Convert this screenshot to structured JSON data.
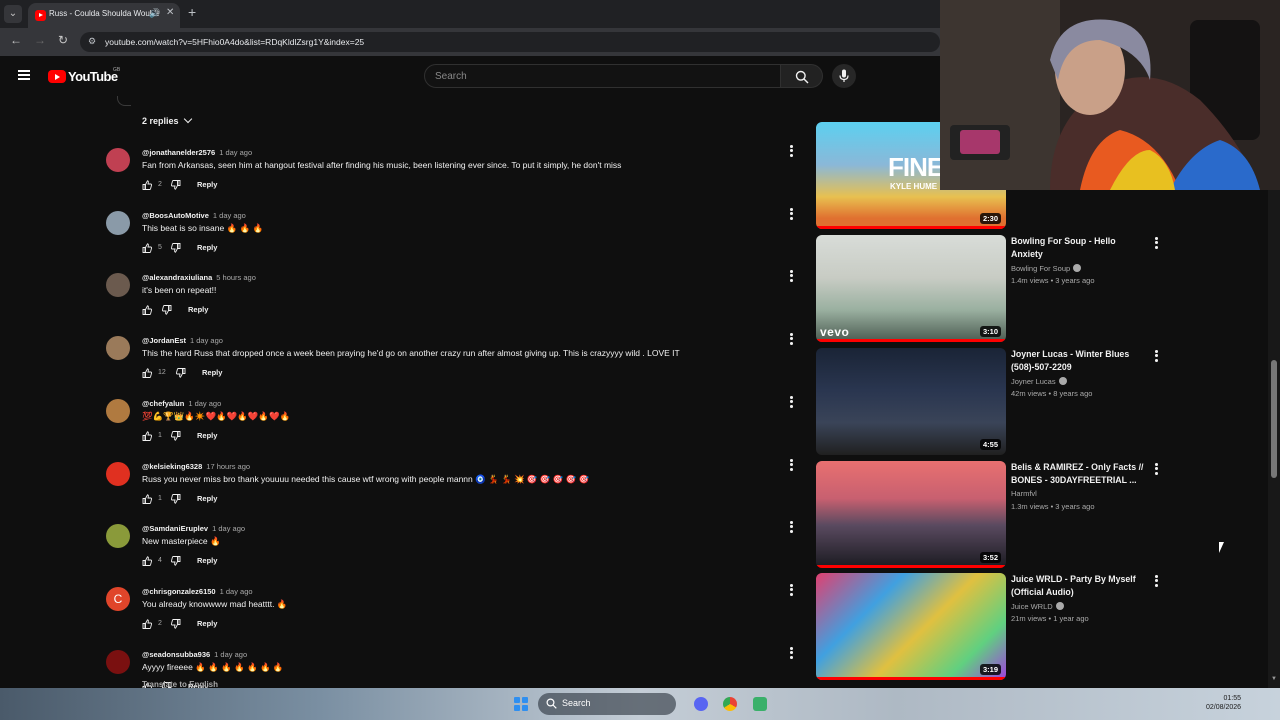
{
  "browser": {
    "tab_title": "Russ - Coulda Shoulda Woulda",
    "url": "youtube.com/watch?v=5HFhio0A4do&list=RDqKldlZsrg1Y&index=25"
  },
  "header": {
    "logo_text": "YouTube",
    "region": "GB",
    "search_placeholder": "Search"
  },
  "thread": {
    "replies_label": "2 replies"
  },
  "comments": [
    {
      "author": "@jonathanelder2576",
      "time": "1 day ago",
      "text": "Fan from Arkansas, seen him at hangout festival after finding his music, been listening ever since. To put it simply, he don't miss",
      "likes": "2",
      "avatar_color": "#c04052"
    },
    {
      "author": "@BoosAutoMotive",
      "time": "1 day ago",
      "text": "This beat is so insane 🔥 🔥 🔥",
      "likes": "5",
      "avatar_color": "#8a9aa8"
    },
    {
      "author": "@alexandraxiuliana",
      "time": "5 hours ago",
      "text": "it's been on repeat!!",
      "likes": "",
      "avatar_color": "#6b5a4e"
    },
    {
      "author": "@JordanEst",
      "time": "1 day ago",
      "text": "This the hard Russ that dropped once a week been praying he'd go on another crazy run after almost giving up. This is crazyyyy wild . LOVE IT",
      "likes": "12",
      "avatar_color": "#9a7a5a"
    },
    {
      "author": "@chefyalun",
      "time": "1 day ago",
      "text": "💯💪🏆👑🔥✴️❤️🔥❤️🔥❤️🔥❤️🔥",
      "likes": "1",
      "avatar_color": "#b07a40"
    },
    {
      "author": "@kelsieking6328",
      "time": "17 hours ago",
      "text": "Russ you never miss bro thank youuuu needed this cause wtf wrong with people mannn 🧿 💃 💃 💥 🎯 🎯 🎯 🎯 🎯",
      "likes": "1",
      "avatar_color": "#e03020"
    },
    {
      "author": "@SamdaniEruplev",
      "time": "1 day ago",
      "text": "New masterpiece 🔥",
      "likes": "4",
      "avatar_color": "#8a9a3a"
    },
    {
      "author": "@chrisgonzalez6150",
      "time": "1 day ago",
      "text": "You already knowwww mad heatttt. 🔥",
      "likes": "2",
      "avatar_color": "#e0452a",
      "avatar_letter": "C"
    },
    {
      "author": "@seadonsubba936",
      "time": "1 day ago",
      "text": "Ayyyy fireeee 🔥 🔥 🔥 🔥 🔥 🔥 🔥",
      "likes": "",
      "avatar_color": "#7a1010"
    }
  ],
  "comment_labels": {
    "reply": "Reply",
    "translate": "Translate to English"
  },
  "sidebar": {
    "videos": [
      {
        "title": "",
        "channel": "",
        "meta": "",
        "duration": "2:30",
        "thumb_text": "FINE",
        "thumb_sub": "KYLE HUME"
      },
      {
        "title": "Bowling For Soup - Hello Anxiety",
        "channel": "Bowling For Soup",
        "meta": "1.4m views • 3 years ago",
        "duration": "3:10",
        "thumb_text": "vevo"
      },
      {
        "title": "Joyner Lucas - Winter Blues (508)-507-2209",
        "channel": "Joyner Lucas",
        "meta": "42m views • 8 years ago",
        "duration": "4:55"
      },
      {
        "title": "Belis & RAMIREZ - Only Facts // BONES - 30DAYFREETRIAL ...",
        "channel": "Harmfvl",
        "meta": "1.3m views • 3 years ago",
        "duration": "3:52"
      },
      {
        "title": "Juice WRLD - Party By Myself (Official Audio)",
        "channel": "Juice WRLD",
        "meta": "21m views • 1 year ago",
        "duration": "3:19"
      }
    ]
  },
  "taskbar": {
    "search_label": "Search",
    "time": "01:55",
    "date": "02/08/2026"
  },
  "colors": {
    "youtube_red": "#ff0000",
    "background": "#0f0f0f",
    "secondary_text": "#aaaaaa"
  }
}
